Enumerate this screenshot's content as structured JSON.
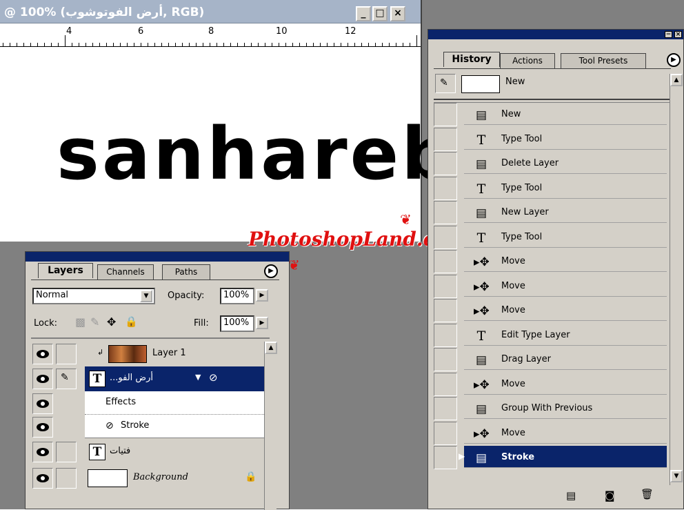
{
  "document": {
    "title": "@ 100% (أرض الفوتوشوب, RGB)",
    "minimize": "_",
    "maximize": "□",
    "close": "×",
    "ruler_numbers": [
      "4",
      "6",
      "8",
      "10",
      "12"
    ],
    "canvas_text": "sanhareb"
  },
  "watermark": "PhotoshopLand.com",
  "history_panel": {
    "tabs": [
      "History",
      "Actions",
      "Tool Presets"
    ],
    "snapshot_label": "New",
    "states": [
      {
        "icon": "doc",
        "label": "New"
      },
      {
        "icon": "type",
        "label": "Type Tool"
      },
      {
        "icon": "doc",
        "label": "Delete Layer"
      },
      {
        "icon": "type",
        "label": "Type Tool"
      },
      {
        "icon": "doc",
        "label": "New Layer"
      },
      {
        "icon": "type",
        "label": "Type Tool"
      },
      {
        "icon": "move",
        "label": "Move"
      },
      {
        "icon": "move",
        "label": "Move"
      },
      {
        "icon": "move",
        "label": "Move"
      },
      {
        "icon": "type",
        "label": "Edit Type Layer"
      },
      {
        "icon": "doc",
        "label": "Drag Layer"
      },
      {
        "icon": "move",
        "label": "Move"
      },
      {
        "icon": "doc",
        "label": "Group With Previous"
      },
      {
        "icon": "move",
        "label": "Move"
      },
      {
        "icon": "doc",
        "label": "Stroke"
      }
    ],
    "selected_label": "Stroke"
  },
  "layers_panel": {
    "tabs": [
      "Layers",
      "Channels",
      "Paths"
    ],
    "blend_mode": "Normal",
    "opacity_label": "Opacity:",
    "opacity_value": "100%",
    "lock_label": "Lock:",
    "fill_label": "Fill:",
    "fill_value": "100%",
    "layers": {
      "layer1": "Layer 1",
      "type1": "...أرض الفو",
      "effects": "Effects",
      "stroke": "Stroke",
      "type2": "فتيات",
      "background": "Background"
    }
  },
  "colors": {
    "selection": "#0a246a",
    "panel_bg": "#d4d0c8",
    "watermark": "#e01010",
    "title_bar": "#a6b4c8"
  }
}
